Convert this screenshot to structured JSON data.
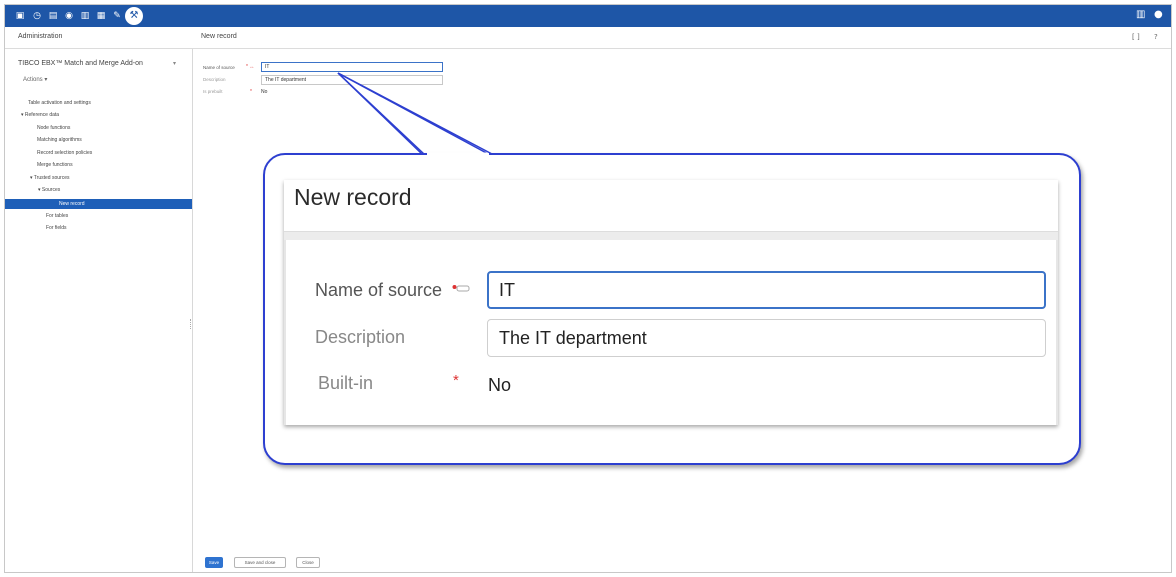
{
  "topbar": {
    "icons": [
      "database-icon",
      "clock-icon",
      "document-icon",
      "speech-icon",
      "dataset-icon",
      "dataspace-icon",
      "pin-icon",
      "wrench-icon"
    ],
    "right_icons": [
      "panel-icon",
      "user-avatar-icon"
    ]
  },
  "header": {
    "admin_title": "Administration",
    "view_title": "New record",
    "fullscreen_glyph": "[ ]",
    "help_glyph": "?"
  },
  "sidebar": {
    "dataset_title": "TIBCO EBX™ Match and Merge Add-on",
    "dataset_caret": "▾",
    "actions_label": "Actions ▾",
    "tree": [
      {
        "label": "Table activation and settings"
      },
      {
        "label": "▾ Reference data"
      },
      {
        "label": "Node functions"
      },
      {
        "label": "Matching algorithms"
      },
      {
        "label": "Record selection policies"
      },
      {
        "label": "Merge functions"
      },
      {
        "label": "▾ Trusted sources"
      },
      {
        "label": "▾ Sources"
      },
      {
        "label": "New record"
      },
      {
        "label": "For tables"
      },
      {
        "label": "For fields"
      }
    ],
    "selected_item": "New record"
  },
  "form": {
    "name_label": "Name of source",
    "name_required": "* ↔",
    "name_value": "IT",
    "description_label": "Description",
    "description_value": "The IT department",
    "builtin_label": "Is prebuilt",
    "builtin_required": "*",
    "builtin_value": "No"
  },
  "buttons": {
    "save": "Save",
    "save_and_close": "Save and close",
    "close": "Close"
  },
  "zoom": {
    "title": "New record",
    "name_label": "Name of source",
    "name_value": "IT",
    "description_label": "Description",
    "description_value": "The IT department",
    "builtin_label": "Built-in",
    "builtin_required": "*",
    "builtin_value": "No"
  },
  "colors": {
    "brand_bar": "#1e56a7",
    "selection": "#1e5fb8",
    "primary_button": "#2f73d0",
    "callout_border": "#2d3fd0",
    "required": "#d33333"
  }
}
